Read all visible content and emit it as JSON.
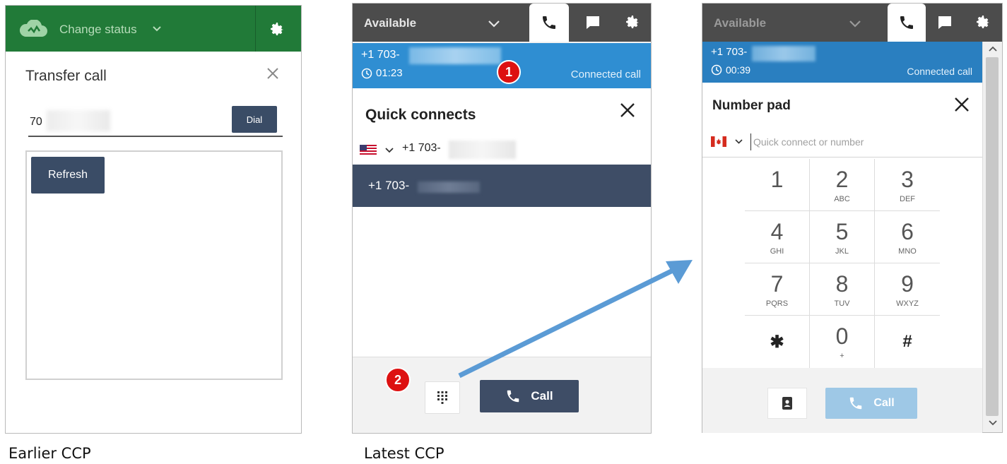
{
  "earlier_ccp": {
    "status_label": "Change status",
    "title": "Transfer call",
    "number_value": "70",
    "dial_label": "Dial",
    "refresh_label": "Refresh",
    "brand_color": "#217a38"
  },
  "latest_ccp": {
    "status": "Available",
    "tabs": [
      "phone",
      "chat",
      "settings"
    ],
    "call": {
      "number": "+1 703-",
      "time": "01:23",
      "state": "Connected call"
    },
    "marker_1": "1",
    "marker_2": "2",
    "quick_connects": {
      "title": "Quick connects",
      "input_value": "+1 703-",
      "items": [
        "+1 703-"
      ]
    },
    "call_label": "Call",
    "accent_color": "#2f8ed2"
  },
  "number_pad_ccp": {
    "status": "Available",
    "call": {
      "number": "+1 703-",
      "time": "00:39",
      "state": "Connected call"
    },
    "title": "Number pad",
    "input_placeholder": "Quick connect or number",
    "keys": [
      {
        "digit": "1",
        "letters": ""
      },
      {
        "digit": "2",
        "letters": "ABC"
      },
      {
        "digit": "3",
        "letters": "DEF"
      },
      {
        "digit": "4",
        "letters": "GHI"
      },
      {
        "digit": "5",
        "letters": "JKL"
      },
      {
        "digit": "6",
        "letters": "MNO"
      },
      {
        "digit": "7",
        "letters": "PQRS"
      },
      {
        "digit": "8",
        "letters": "TUV"
      },
      {
        "digit": "9",
        "letters": "WXYZ"
      },
      {
        "digit": "✱",
        "letters": ""
      },
      {
        "digit": "0",
        "letters": "+"
      },
      {
        "digit": "#",
        "letters": ""
      }
    ],
    "call_label": "Call"
  },
  "captions": {
    "earlier": "Earlier CCP",
    "latest": "Latest CCP"
  }
}
